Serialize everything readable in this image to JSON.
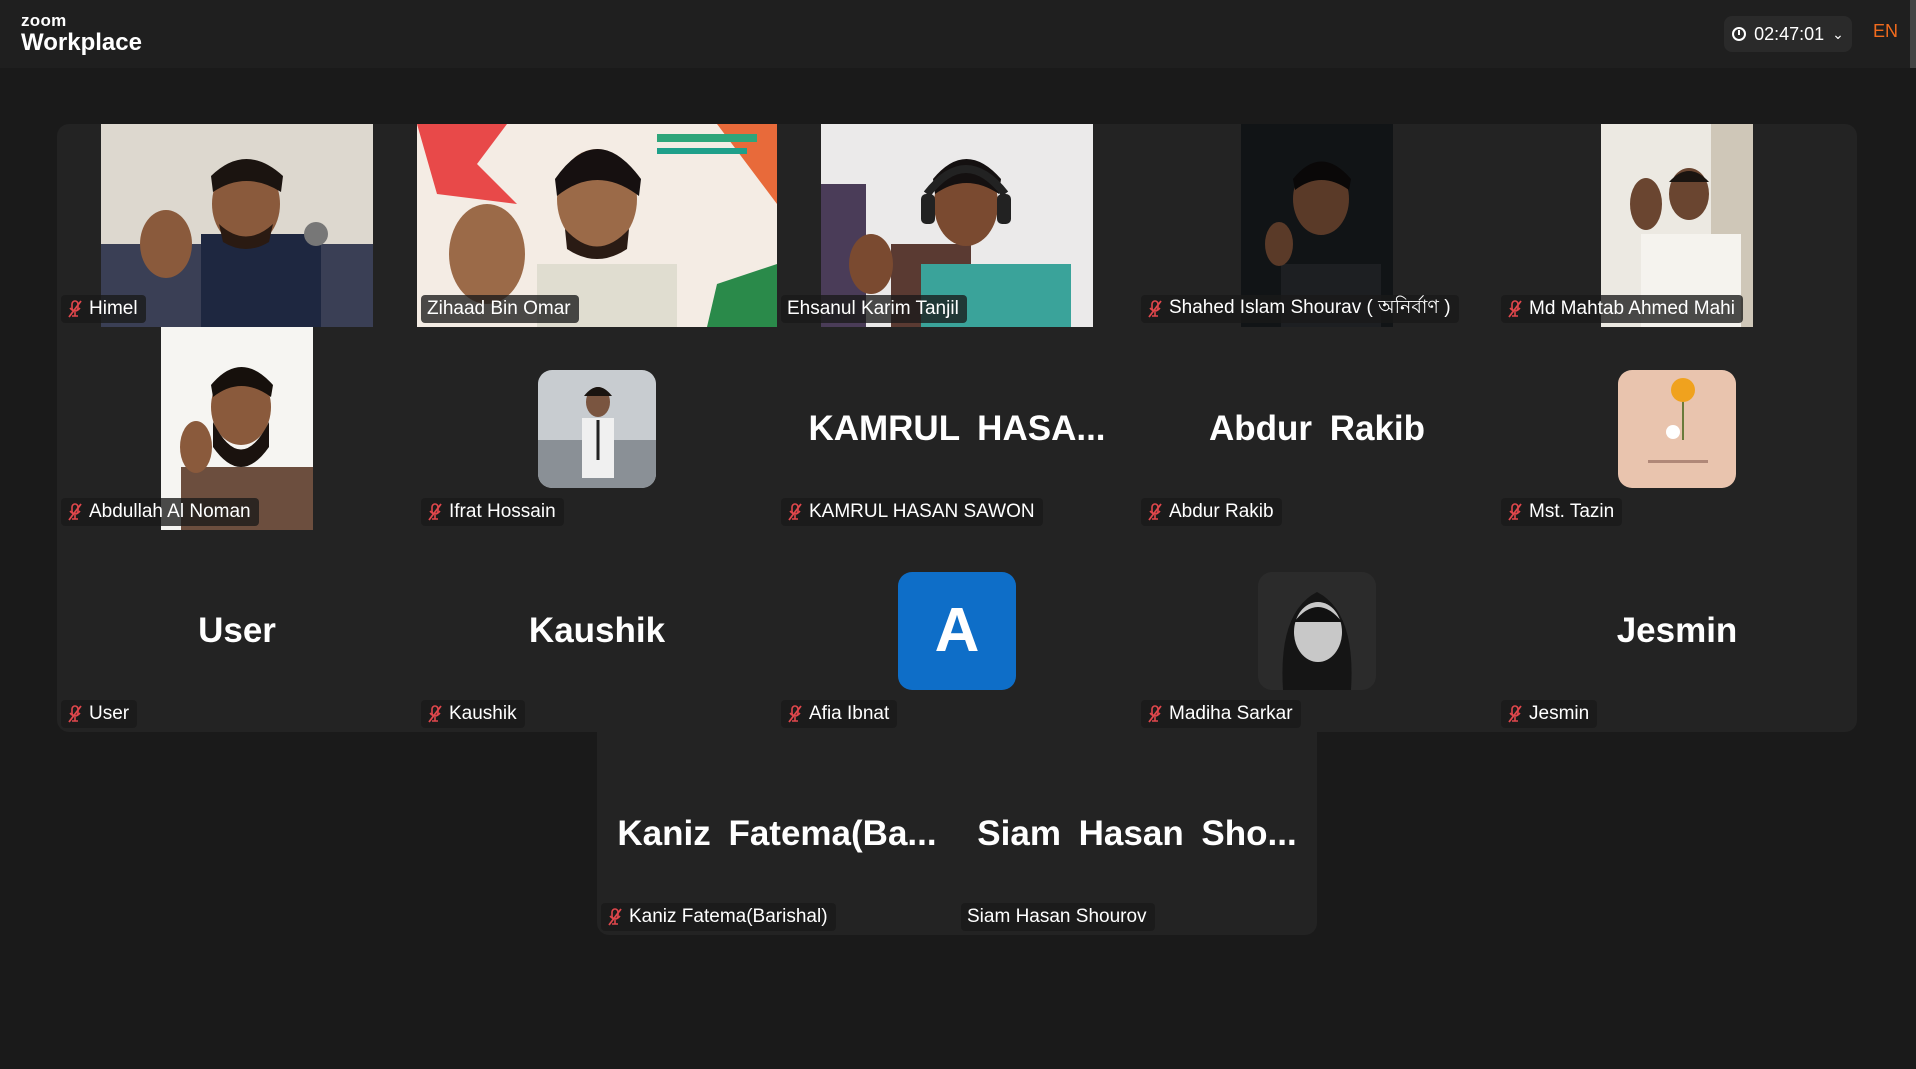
{
  "app": {
    "brand_small": "zoom",
    "brand_large": "Workplace"
  },
  "topbar": {
    "timer": "02:47:01",
    "language": "EN"
  },
  "participants": [
    {
      "name": "Himel"
    },
    {
      "name": "Zihaad Bin Omar"
    },
    {
      "name": "Ehsanul Karim Tanjil"
    },
    {
      "name": "Shahed Islam Shourav ( অনির্বাণ )"
    },
    {
      "name": "Md Mahtab Ahmed Mahi"
    },
    {
      "name": "Abdullah Al Noman"
    },
    {
      "name": "Ifrat Hossain"
    },
    {
      "name": "KAMRUL HASAN SAWON",
      "display": "KAMRUL  HASA..."
    },
    {
      "name": "Abdur Rakib",
      "display": "Abdur Rakib"
    },
    {
      "name": "Mst. Tazin"
    },
    {
      "name": "User",
      "display": "User"
    },
    {
      "name": "Kaushik",
      "display": "Kaushik"
    },
    {
      "name": "Afia Ibnat",
      "avatar_letter": "A"
    },
    {
      "name": "Madiha Sarkar"
    },
    {
      "name": "Jesmin",
      "display": "Jesmin"
    },
    {
      "name": "Kaniz Fatema(Barishal)",
      "display": "Kaniz  Fatema(Ba..."
    },
    {
      "name": "Siam Hasan Shourov",
      "display": "Siam  Hasan  Sho..."
    }
  ],
  "colors": {
    "active_speaker": "#23d996",
    "muted_icon": "#e0474c",
    "avatar_bg": "#0e6ec8",
    "lang": "#f26b1d"
  }
}
